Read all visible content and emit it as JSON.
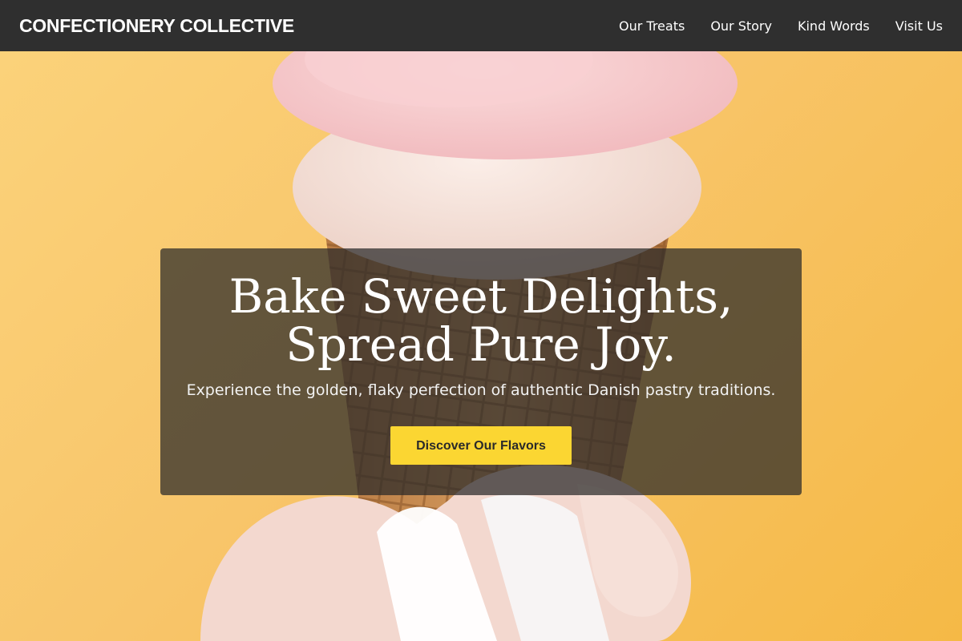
{
  "nav": {
    "brand": "CONFECTIONERY COLLECTIVE",
    "links": [
      "Our Treats",
      "Our Story",
      "Kind Words",
      "Visit Us"
    ]
  },
  "hero": {
    "title_line1": "Bake Sweet Delights,",
    "title_line2": "Spread Pure Joy.",
    "subtitle": "Experience the golden, flaky perfection of authentic Danish pastry traditions.",
    "cta_label": "Discover Our Flavors"
  },
  "colors": {
    "nav_background": "#2f2f2f",
    "hero_background": "#f8c56a",
    "cta_background": "#fbd632",
    "panel_overlay": "#282828"
  },
  "icons": {
    "hero_image": "ice-cream-cone-image"
  }
}
